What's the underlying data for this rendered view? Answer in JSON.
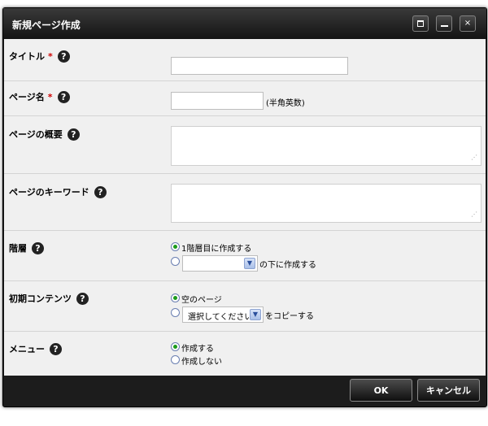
{
  "dialog": {
    "title": "新規ページ作成",
    "controls": {
      "maximize": "maximize-icon",
      "minimize": "minimize-icon",
      "close": "×"
    }
  },
  "form": {
    "title_field": {
      "label": "タイトル",
      "required_mark": "*",
      "value": ""
    },
    "page_name": {
      "label": "ページ名",
      "required_mark": "*",
      "value": "",
      "note": "(半角英数)"
    },
    "summary": {
      "label": "ページの概要",
      "value": ""
    },
    "keywords": {
      "label": "ページのキーワード",
      "value": ""
    },
    "hierarchy": {
      "label": "階層",
      "option1": "1階層目に作成する",
      "option2_select": "",
      "option2_suffix": "の下に作成する"
    },
    "initial_content": {
      "label": "初期コンテンツ",
      "option1": "空のページ",
      "option2_select": "選択してください",
      "option2_suffix": "をコピーする"
    },
    "menu": {
      "label": "メニュー",
      "option1": "作成する",
      "option2": "作成しない"
    },
    "help_glyph": "?"
  },
  "buttons": {
    "ok": "OK",
    "cancel": "キャンセル"
  },
  "colors": {
    "accent_green": "#1a9b1a",
    "required_red": "#d00000",
    "titlebar": "#1c1c1c"
  }
}
